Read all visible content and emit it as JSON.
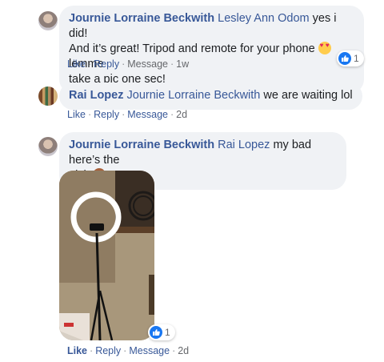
{
  "comments": [
    {
      "author": "Journie Lorraine Beckwith",
      "mention": "Lesley Ann Odom",
      "text_line1": " yes i did!",
      "text_line2": "And it’s great! Tripod and remote for your phone ",
      "text_line2_end": " lemme",
      "text_line3": "take a pic one sec!",
      "emoji": "heart-eyes-emoji",
      "actions": {
        "like": "Like",
        "reply": "Reply",
        "message": "Message",
        "time": "1w"
      },
      "reaction_count": "1"
    },
    {
      "author": "Rai Lopez",
      "mention": "Journie Lorraine Beckwith",
      "text": " we are waiting lol",
      "actions": {
        "like": "Like",
        "reply": "Reply",
        "message": "Message",
        "time": "2d"
      }
    },
    {
      "author": "Journie Lorraine Beckwith",
      "mention": "Rai Lopez",
      "text_line1": " my bad here’s the",
      "text_line2": "pick ",
      "emoji": "woman-tipping-hand-emoji",
      "photo": "ring-light-tripod-photo",
      "actions": {
        "like": "Like",
        "reply": "Reply",
        "message": "Message",
        "time": "2d"
      },
      "reaction_count": "1"
    }
  ],
  "colors": {
    "link": "#385898",
    "bubble": "#f0f2f5",
    "meta": "#65676b",
    "like_blue": "#1877f2"
  }
}
